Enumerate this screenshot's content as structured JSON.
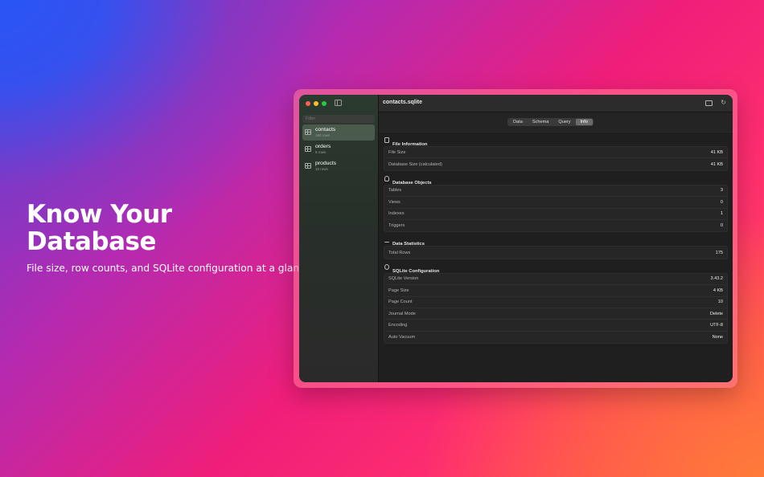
{
  "hero": {
    "title_line1": "Know Your",
    "title_line2": "Database",
    "subtitle": "File size, row counts, and SQLite configuration at a glance."
  },
  "window": {
    "title": "contacts.sqlite",
    "filter_placeholder": "Filter"
  },
  "sidebar": {
    "tables": [
      {
        "name": "contacts",
        "rows": "160 rows"
      },
      {
        "name": "orders",
        "rows": "5 rows"
      },
      {
        "name": "products",
        "rows": "10 rows"
      }
    ]
  },
  "tabs": [
    "Data",
    "Schema",
    "Query",
    "Info"
  ],
  "sections": {
    "file": {
      "title": "File Information",
      "rows": [
        {
          "label": "File Size",
          "value": "41 KB"
        },
        {
          "label": "Database Size (calculated)",
          "value": "41 KB"
        }
      ]
    },
    "objects": {
      "title": "Database Objects",
      "rows": [
        {
          "label": "Tables",
          "value": "3"
        },
        {
          "label": "Views",
          "value": "0"
        },
        {
          "label": "Indexes",
          "value": "1"
        },
        {
          "label": "Triggers",
          "value": "0"
        }
      ]
    },
    "stats": {
      "title": "Data Statistics",
      "rows": [
        {
          "label": "Total Rows",
          "value": "175"
        }
      ]
    },
    "config": {
      "title": "SQLite Configuration",
      "rows": [
        {
          "label": "SQLite Version",
          "value": "3.43.2"
        },
        {
          "label": "Page Size",
          "value": "4 KB"
        },
        {
          "label": "Page Count",
          "value": "10"
        },
        {
          "label": "Journal Mode",
          "value": "Delete"
        },
        {
          "label": "Encoding",
          "value": "UTF-8"
        },
        {
          "label": "Auto Vacuum",
          "value": "None"
        }
      ]
    }
  }
}
